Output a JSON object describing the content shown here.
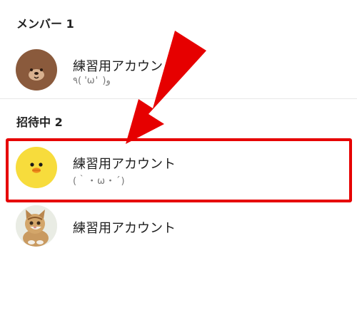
{
  "members": {
    "header": "メンバー 1",
    "items": [
      {
        "name": "練習用アカウント",
        "status": "٩( 'ω' )و",
        "avatar": "brown-bear-avatar"
      }
    ]
  },
  "invited": {
    "header": "招待中 2",
    "items": [
      {
        "name": "練習用アカウント",
        "status": "(｀・ω・´)",
        "avatar": "yellow-chick-avatar"
      },
      {
        "name": "練習用アカウント",
        "status": "",
        "avatar": "kitten-photo-avatar"
      }
    ]
  },
  "colors": {
    "annotation": "#e60000",
    "chick": "#f7dc3c",
    "bear": "#8a5a3c"
  }
}
